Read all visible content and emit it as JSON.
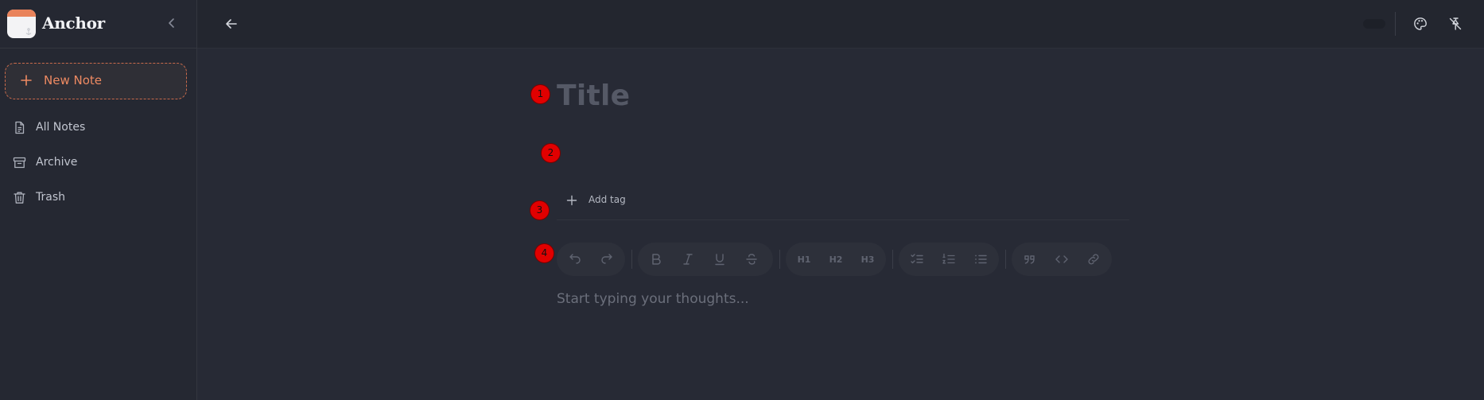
{
  "app": {
    "name": "Anchor"
  },
  "sidebar": {
    "new_note_label": "New Note",
    "items": [
      {
        "label": "All Notes",
        "icon": "document-icon"
      },
      {
        "label": "Archive",
        "icon": "archive-icon"
      },
      {
        "label": "Trash",
        "icon": "trash-icon"
      }
    ]
  },
  "editor": {
    "title_placeholder": "Title",
    "add_tag_label": "Add tag",
    "body_placeholder": "Start typing your thoughts...",
    "toolbar": {
      "heading_labels": [
        "H1",
        "H2",
        "H3"
      ]
    }
  },
  "annotations": [
    "1",
    "2",
    "3",
    "4"
  ],
  "colors": {
    "accent": "#ee8a62",
    "background": "#272a35",
    "sidebar": "#252832",
    "badge": "#e10000"
  }
}
